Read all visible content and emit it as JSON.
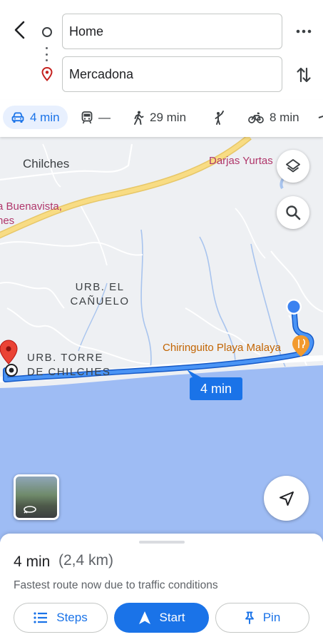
{
  "header": {
    "origin_value": "Home",
    "destination_value": "Mercadona"
  },
  "modes": [
    {
      "name": "driving",
      "icon": "car-icon",
      "label": "4 min",
      "active": true
    },
    {
      "name": "transit",
      "icon": "train-icon",
      "label": "—"
    },
    {
      "name": "walking",
      "icon": "walk-icon",
      "label": "29 min"
    },
    {
      "name": "ride",
      "icon": "hail-icon",
      "label": ""
    },
    {
      "name": "cycling",
      "icon": "bike-icon",
      "label": "8 min"
    }
  ],
  "map": {
    "labels": {
      "chilches": "Chilches",
      "darjas": "Darjas Yurtas",
      "buenavista_line1": "a Buenavista,",
      "buenavista_line2": "hes",
      "canuelo_line1": "URB. EL",
      "canuelo_line2": "CAÑUELO",
      "torre_line1": "URB. TORRE",
      "torre_line2": "DE CHILCHES",
      "chiringuito": "Chiringuito Playa Malaya"
    },
    "route_label": "4 min",
    "colors": {
      "route": "#1a73e8",
      "sea": "#9ebcf4",
      "land": "#eef0f3",
      "highway": "#f6d365",
      "pin": "#ea4335"
    }
  },
  "sheet": {
    "eta": "4 min",
    "distance": "(2,4 km)",
    "summary": "Fastest route now due to traffic conditions",
    "steps_label": "Steps",
    "start_label": "Start",
    "pin_label": "Pin"
  }
}
